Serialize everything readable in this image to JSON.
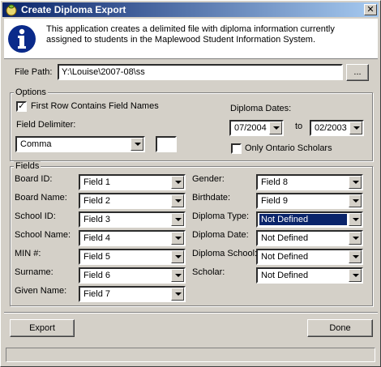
{
  "window": {
    "title": "Create Diploma Export",
    "close_label": "✕"
  },
  "info": {
    "icon": "info-icon",
    "text": "This application creates a delimited file with diploma information currently assigned to students  in the Maplewood Student Information System."
  },
  "file_path": {
    "label": "File Path:",
    "value": "Y:\\Louise\\2007-08\\ss",
    "browse_label": "..."
  },
  "options": {
    "title": "Options",
    "first_row_label": "First Row Contains Field Names",
    "first_row_checked": true,
    "delimiter_label": "Field Delimiter:",
    "delimiter_value": "Comma",
    "delimiter_custom": "",
    "diploma_dates_label": "Diploma Dates:",
    "date_from": "07/2004",
    "to_label": "to",
    "date_to": "02/2003",
    "ontario_label": "Only Ontario Scholars",
    "ontario_checked": false
  },
  "fields": {
    "title": "Fields",
    "left": [
      {
        "label": "Board ID:",
        "value": "Field 1"
      },
      {
        "label": "Board Name:",
        "value": "Field 2"
      },
      {
        "label": "School ID:",
        "value": "Field 3"
      },
      {
        "label": "School Name:",
        "value": "Field 4"
      },
      {
        "label": "MIN #:",
        "value": "Field 5"
      },
      {
        "label": "Surname:",
        "value": "Field 6"
      },
      {
        "label": "Given Name:",
        "value": "Field 7"
      }
    ],
    "right": [
      {
        "label": "Gender:",
        "value": "Field 8"
      },
      {
        "label": "Birthdate:",
        "value": "Field 9"
      },
      {
        "label": "Diploma Type:",
        "value": "Not Defined"
      },
      {
        "label": "Diploma Date:",
        "value": "Not Defined"
      },
      {
        "label": "Diploma School:",
        "value": "Not Defined"
      },
      {
        "label": "Scholar:",
        "value": "Not Defined"
      }
    ]
  },
  "buttons": {
    "export_label": "Export",
    "done_label": "Done"
  },
  "status": {
    "text": ""
  }
}
